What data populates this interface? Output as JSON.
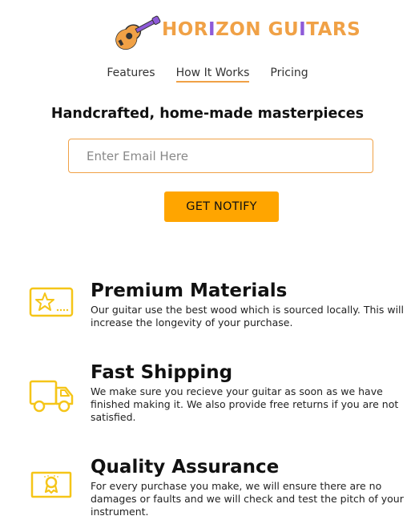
{
  "brand": {
    "name_parts": [
      "HOR",
      "I",
      "ZON GU",
      "I",
      "TARS"
    ],
    "colors": {
      "primary": "#f0a146",
      "accent": "#8e5ad8"
    },
    "logo_icon": "guitar-icon"
  },
  "nav": {
    "items": [
      {
        "label": "Features",
        "active": false
      },
      {
        "label": "How It Works",
        "active": true
      },
      {
        "label": "Pricing",
        "active": false
      }
    ]
  },
  "hero": {
    "tagline": "Handcrafted, home-made masterpieces",
    "email_placeholder": "Enter Email Here",
    "email_value": "",
    "button_label": "GET NOTIFY",
    "button_color": "#ffa500"
  },
  "features": [
    {
      "icon": "star-card-icon",
      "title": "Premium Materials",
      "description": "Our guitar use the best wood which is sourced locally. This will increase the longevity of your purchase."
    },
    {
      "icon": "truck-icon",
      "title": "Fast Shipping",
      "description": "We make sure you recieve your guitar as soon as we have finished making it. We also provide free returns if you are not satisfied."
    },
    {
      "icon": "certificate-icon",
      "title": "Quality Assurance",
      "description": "For every purchase you make, we will ensure there are no damages or faults and we will check and test the pitch of your instrument."
    }
  ],
  "icon_color": "#f5c518"
}
